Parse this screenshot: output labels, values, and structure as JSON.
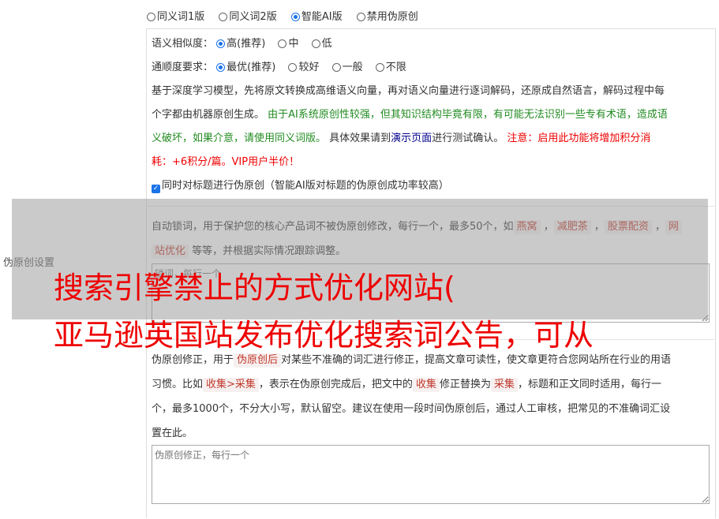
{
  "mode_options": [
    {
      "label": "同义词1版",
      "checked": false
    },
    {
      "label": "同义词2版",
      "checked": false
    },
    {
      "label": "智能AI版",
      "checked": true
    },
    {
      "label": "禁用伪原创",
      "checked": false
    }
  ],
  "similarity": {
    "label": "语义相似度：",
    "options": [
      {
        "label": "高(推荐)",
        "checked": true
      },
      {
        "label": "中",
        "checked": false
      },
      {
        "label": "低",
        "checked": false
      }
    ]
  },
  "fluency": {
    "label": "通顺度要求：",
    "options": [
      {
        "label": "最优(推荐)",
        "checked": true
      },
      {
        "label": "较好",
        "checked": false
      },
      {
        "label": "一般",
        "checked": false
      },
      {
        "label": "不限",
        "checked": false
      }
    ]
  },
  "description": {
    "part1": "基于深度学习模型，先将原文转换成高维语义向量，再对语义向量进行逐词解码，还原成自然语言，解码过程中每",
    "part2": "个字都由机器原创生成。",
    "green1": "由于AI系统原创性较强，但其知识结构毕竟有限，有可能无法识别一些专有术语，造成语",
    "green2": "义破坏，如果介意，请使用同义词版。",
    "part3": "具体效果请到",
    "link": "演示页面",
    "part4": "进行测试确认。",
    "red1": "注意：启用此功能将增加积分消",
    "red2": "耗：+6积分/篇。VIP用户半价！"
  },
  "title_checkbox": {
    "label": "同时对标题进行伪原创（智能AI版对标题的伪原创成功率较高）",
    "checked": true
  },
  "side_label": "伪原创设置",
  "lock_words": {
    "text1": "自动锁词，用于保护您的核心产品词不被伪原创修改，每行一个，最多50个，如",
    "tags": [
      "燕窝",
      "减肥茶",
      "股票配资",
      "网"
    ],
    "tag_last_cont": "站优化",
    "text2": "等等，并根据实际情况跟踪调整。",
    "placeholder": "锁词，每行一个"
  },
  "correction": {
    "line1a": "伪原创修正，用于",
    "tag1": "伪原创后",
    "line1b": "对某些不准确的词汇进行修正，提高文章可读性，使文章更符合您网站所在行业的用语",
    "line2a": "习惯。比如",
    "tag2": "收集>采集",
    "line2b": "，表示在伪原创完成后，把文中的",
    "tag3": "收集",
    "line2c": "修正替换为",
    "tag4": "采集",
    "line2d": "，标题和正文同时适用，每行一",
    "line3": "个，最多1000个，不分大小写，默认留空。建议在使用一段时间伪原创后，通过人工审核，把常见的不准确词汇设",
    "line4": "置在此。",
    "placeholder": "伪原创修正，每行一个"
  },
  "overlay": {
    "line1": "搜索引擎禁止的方式优化网站(",
    "line2": "亚马逊英国站发布优化搜索词公告，可从"
  },
  "colors": {
    "accent": "#1a73e8",
    "red": "#ee0000",
    "green": "#228b22"
  }
}
